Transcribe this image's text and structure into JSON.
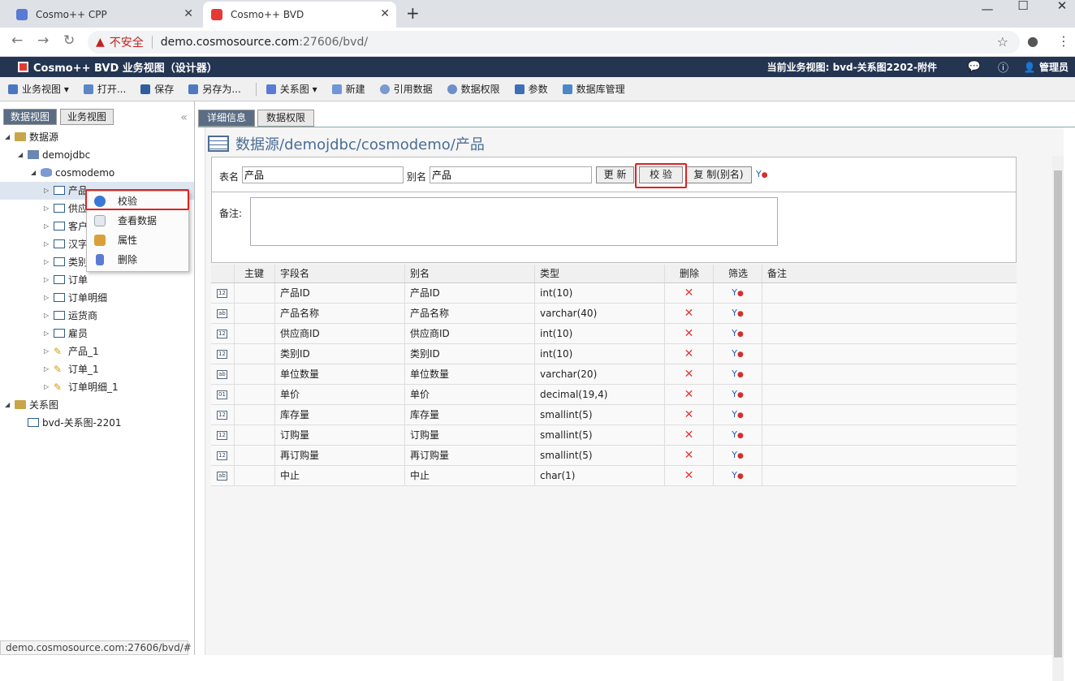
{
  "browser": {
    "tabs": [
      {
        "title": "Cosmo++ CPP",
        "favicon_color": "#5a7bd4"
      },
      {
        "title": "Cosmo++ BVD",
        "favicon_color": "#e53935"
      }
    ],
    "security_label": "不安全",
    "url_host": "demo.cosmosource.com",
    "url_path": ":27606/bvd/",
    "status_url": "demo.cosmosource.com:27606/bvd/#"
  },
  "app": {
    "title": "Cosmo++ BVD 业务视图（设计器）",
    "current_view": "当前业务视图: bvd-关系图2202-附件",
    "user": "管理员",
    "header_color": "#243552"
  },
  "toolbar": {
    "items": [
      {
        "label": "业务视图 ▾",
        "icon": "view-icon"
      },
      {
        "label": "打开...",
        "icon": "open-icon"
      },
      {
        "label": "保存",
        "icon": "save-icon"
      },
      {
        "label": "另存为...",
        "icon": "saveas-icon"
      },
      {
        "label": "关系图 ▾",
        "icon": "relation-icon"
      },
      {
        "label": "新建",
        "icon": "new-icon"
      },
      {
        "label": "引用数据",
        "icon": "refdata-icon"
      },
      {
        "label": "数据权限",
        "icon": "permission-icon"
      },
      {
        "label": "参数",
        "icon": "param-icon"
      },
      {
        "label": "数据库管理",
        "icon": "dbmanage-icon"
      }
    ]
  },
  "left": {
    "tabs": [
      "数据视图",
      "业务视图"
    ],
    "tree": [
      {
        "label": "数据源",
        "level": 0,
        "arrow": "◢",
        "icon": "folder"
      },
      {
        "label": "demojdbc",
        "level": 1,
        "arrow": "◢",
        "icon": "server"
      },
      {
        "label": "cosmodemo",
        "level": 2,
        "arrow": "◢",
        "icon": "db"
      },
      {
        "label": "产品",
        "level": 3,
        "arrow": "▷",
        "icon": "table",
        "selected": true
      },
      {
        "label": "供应商",
        "level": 3,
        "arrow": "▷",
        "icon": "table"
      },
      {
        "label": "客户",
        "level": 3,
        "arrow": "▷",
        "icon": "table"
      },
      {
        "label": "汉字",
        "level": 3,
        "arrow": "▷",
        "icon": "table"
      },
      {
        "label": "类别",
        "level": 3,
        "arrow": "▷",
        "icon": "table"
      },
      {
        "label": "订单",
        "level": 3,
        "arrow": "▷",
        "icon": "table"
      },
      {
        "label": "订单明细",
        "level": 3,
        "arrow": "▷",
        "icon": "table"
      },
      {
        "label": "运货商",
        "level": 3,
        "arrow": "▷",
        "icon": "table"
      },
      {
        "label": "雇员",
        "level": 3,
        "arrow": "▷",
        "icon": "table"
      },
      {
        "label": "产品_1",
        "level": 3,
        "arrow": "▷",
        "icon": "view"
      },
      {
        "label": "订单_1",
        "level": 3,
        "arrow": "▷",
        "icon": "view"
      },
      {
        "label": "订单明细_1",
        "level": 3,
        "arrow": "▷",
        "icon": "view"
      },
      {
        "label": "关系图",
        "level": 0,
        "arrow": "◢",
        "icon": "folder"
      },
      {
        "label": "bvd-关系图-2201",
        "level": 1,
        "arrow": "",
        "icon": "rel"
      }
    ],
    "context_menu": [
      {
        "label": "校验",
        "icon": "check-icon",
        "color": "#3a78d8"
      },
      {
        "label": "查看数据",
        "icon": "view-data-icon",
        "color": "#9aa8b8"
      },
      {
        "label": "属性",
        "icon": "property-icon",
        "color": "#d9a03a"
      },
      {
        "label": "删除",
        "icon": "delete-icon",
        "color": "#5a7bd4"
      }
    ]
  },
  "detail": {
    "tabs": [
      "详细信息",
      "数据权限"
    ],
    "heading": "数据源/demojdbc/cosmodemo/产品",
    "table_name_label": "表名",
    "table_name_value": "产品",
    "alias_label": "别名",
    "alias_value": "产品",
    "update_button": "更 新",
    "verify_button": "校 验",
    "copy_button": "复 制(别名)",
    "remark_label": "备注:",
    "columns": [
      "主键",
      "字段名",
      "别名",
      "类型",
      "删除",
      "筛选",
      "备注"
    ],
    "rows": [
      {
        "icon": "12",
        "name": "产品ID",
        "alias": "产品ID",
        "type": "int(10)"
      },
      {
        "icon": "ab",
        "name": "产品名称",
        "alias": "产品名称",
        "type": "varchar(40)"
      },
      {
        "icon": "12",
        "name": "供应商ID",
        "alias": "供应商ID",
        "type": "int(10)"
      },
      {
        "icon": "12",
        "name": "类别ID",
        "alias": "类别ID",
        "type": "int(10)"
      },
      {
        "icon": "ab",
        "name": "单位数量",
        "alias": "单位数量",
        "type": "varchar(20)"
      },
      {
        "icon": "01",
        "name": "单价",
        "alias": "单价",
        "type": "decimal(19,4)"
      },
      {
        "icon": "12",
        "name": "库存量",
        "alias": "库存量",
        "type": "smallint(5)"
      },
      {
        "icon": "12",
        "name": "订购量",
        "alias": "订购量",
        "type": "smallint(5)"
      },
      {
        "icon": "12",
        "name": "再订购量",
        "alias": "再订购量",
        "type": "smallint(5)"
      },
      {
        "icon": "ab",
        "name": "中止",
        "alias": "中止",
        "type": "char(1)"
      }
    ],
    "delete_glyph": "✕",
    "filter_glyph": "Y"
  }
}
